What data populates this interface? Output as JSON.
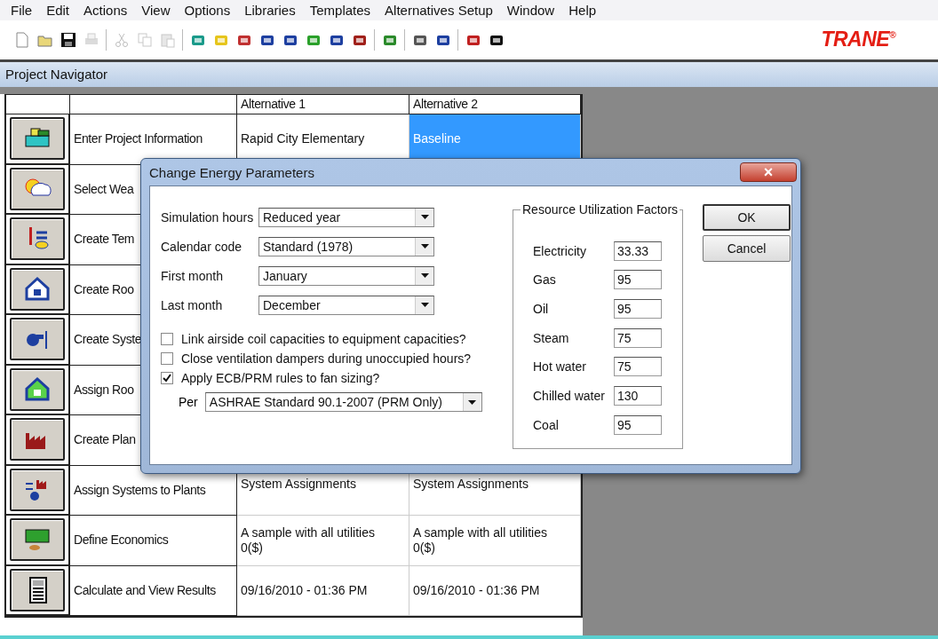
{
  "menu": [
    "File",
    "Edit",
    "Actions",
    "View",
    "Options",
    "Libraries",
    "Templates",
    "Alternatives Setup",
    "Window",
    "Help"
  ],
  "toolbar": [
    [
      {
        "disabled": false
      },
      {
        "disabled": false
      },
      {
        "disabled": false
      },
      {
        "disabled": true
      }
    ],
    [
      {
        "disabled": true
      },
      {
        "disabled": true
      },
      {
        "disabled": true
      }
    ],
    [
      {
        "disabled": false
      },
      {
        "disabled": false
      },
      {
        "disabled": false
      },
      {
        "disabled": false
      },
      {
        "disabled": false
      },
      {
        "disabled": false
      },
      {
        "disabled": false
      },
      {
        "disabled": false
      }
    ],
    [
      {
        "disabled": false
      }
    ],
    [
      {
        "disabled": false
      },
      {
        "disabled": false
      }
    ],
    [
      {
        "disabled": false
      },
      {
        "disabled": false
      }
    ]
  ],
  "logo": "TRANE",
  "logo_mark": "®",
  "navigator": {
    "title": "Project Navigator",
    "columns": [
      "Alternative 1",
      "Alternative 2"
    ],
    "rows": [
      {
        "label": "Enter Project Information",
        "cells": [
          {
            "text": "Rapid City Elementary",
            "selected": false
          },
          {
            "text": "Baseline",
            "selected": true
          }
        ]
      },
      {
        "label": "Select Wea",
        "cells": []
      },
      {
        "label": "Create Tem",
        "cells": []
      },
      {
        "label": "Create Roo",
        "cells": []
      },
      {
        "label": "Create Syste",
        "cells": []
      },
      {
        "label": "Assign Roo",
        "cells": []
      },
      {
        "label": "Create Plan",
        "cells": []
      },
      {
        "label": "Assign Systems to Plants",
        "cells": [
          {
            "text": "System Assignments",
            "selected": false
          },
          {
            "text": "System Assignments",
            "selected": false
          }
        ]
      },
      {
        "label": "Define Economics",
        "cells": [
          {
            "text": "A sample with all utilities\n0($)",
            "selected": false
          },
          {
            "text": "A sample with all utilities\n0($)",
            "selected": false
          }
        ]
      },
      {
        "label": "Calculate and View Results",
        "cells": [
          {
            "text": "09/16/2010 - 01:36 PM",
            "selected": false
          },
          {
            "text": "09/16/2010 - 01:36 PM",
            "selected": false
          }
        ]
      }
    ]
  },
  "dialog": {
    "title": "Change Energy Parameters",
    "close": "×",
    "combos": [
      {
        "label": "Simulation hours",
        "value": "Reduced year"
      },
      {
        "label": "Calendar code",
        "value": "Standard (1978)"
      },
      {
        "label": "First month",
        "value": "January"
      },
      {
        "label": "Last month",
        "value": "December"
      }
    ],
    "checkboxes": [
      {
        "label": "Link airside coil capacities to equipment capacities?",
        "checked": false
      },
      {
        "label": "Close ventilation dampers during unoccupied hours?",
        "checked": false
      },
      {
        "label": "Apply ECB/PRM rules to fan sizing?",
        "checked": true
      }
    ],
    "per": {
      "label": "Per",
      "value": "ASHRAE Standard 90.1-2007 (PRM Only)"
    },
    "factors": {
      "title": "Resource Utilization Factors",
      "items": [
        {
          "label": "Electricity",
          "value": "33.33"
        },
        {
          "label": "Gas",
          "value": "95"
        },
        {
          "label": "Oil",
          "value": "95"
        },
        {
          "label": "Steam",
          "value": "75"
        },
        {
          "label": "Hot water",
          "value": "75"
        },
        {
          "label": "Chilled water",
          "value": "130"
        },
        {
          "label": "Coal",
          "value": "95"
        }
      ]
    },
    "buttons": [
      {
        "label": "OK",
        "default": true
      },
      {
        "label": "Cancel",
        "default": false
      }
    ]
  }
}
